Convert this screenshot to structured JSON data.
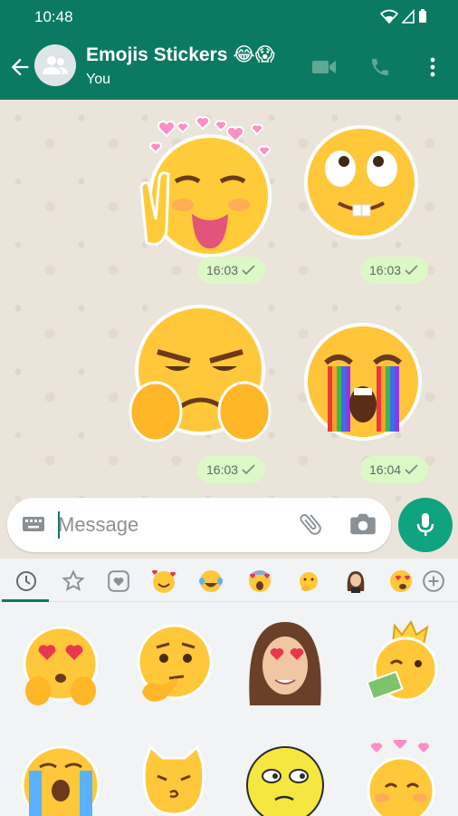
{
  "status_bar": {
    "time": "10:48"
  },
  "header": {
    "title": "Emojis Stickers 😂😱",
    "subtitle": "You"
  },
  "messages": [
    {
      "sticker": "heart-crown-tongue-peace-emoji",
      "time": "16:03"
    },
    {
      "sticker": "goofy-buck-teeth-emoji",
      "time": "16:03"
    },
    {
      "sticker": "grumpy-thumbs-down-emoji",
      "time": "16:03"
    },
    {
      "sticker": "rainbow-crying-emoji",
      "time": "16:04"
    }
  ],
  "composer": {
    "placeholder": "Message"
  },
  "tray": {
    "tabs": [
      "recent",
      "favorites",
      "stickers",
      "smiling-hearts",
      "laughing",
      "screaming",
      "thinking",
      "woman-memoji",
      "heart-eyes",
      "add"
    ],
    "stickers": [
      "heart-eyes-hands-emoji",
      "thinking-face-emoji",
      "heart-eyes-woman-memoji",
      "king-money-emoji",
      "loudly-crying-emoji",
      "cat-kiss-emoji",
      "unamused-yellow-face",
      "heart-crown-emoji"
    ]
  },
  "colors": {
    "header": "#0c7a62",
    "accent": "#0fa37f",
    "bubble": "#dcf8c6"
  }
}
